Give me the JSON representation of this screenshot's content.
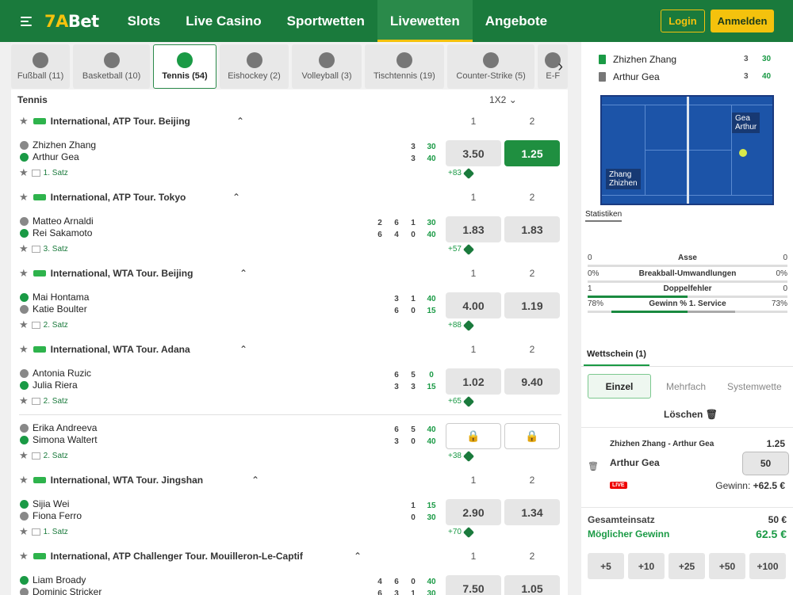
{
  "header": {
    "logo_a": "7A",
    "logo_b": "Bet",
    "nav": [
      "Slots",
      "Live Casino",
      "Sportwetten",
      "Livewetten",
      "Angebote"
    ],
    "login": "Login",
    "register": "Anmelden"
  },
  "sports": [
    {
      "label": "Fußball (11)",
      "icon": "soccer-ball-icon"
    },
    {
      "label": "Basketball (10)",
      "icon": "basketball-icon"
    },
    {
      "label": "Tennis (54)",
      "icon": "tennis-ball-icon"
    },
    {
      "label": "Eishockey (2)",
      "icon": "hockey-stick-icon"
    },
    {
      "label": "Volleyball (3)",
      "icon": "volleyball-icon"
    },
    {
      "label": "Tischtennis (19)",
      "icon": "table-tennis-icon"
    },
    {
      "label": "Counter-Strike (5)",
      "icon": "counter-strike-icon"
    },
    {
      "label": "E-F",
      "icon": "esports-icon"
    }
  ],
  "list": {
    "title": "Tennis",
    "market": "1X2",
    "col1": "1",
    "col2": "2",
    "leagues": [
      "International, ATP Tour. Beijing",
      "International, ATP Tour. Tokyo",
      "International, WTA Tour. Beijing",
      "International, WTA Tour. Adana",
      "International, WTA Tour. Jingshan",
      "International, ATP Challenger Tour. Mouilleron-Le-Captif"
    ],
    "matches": [
      {
        "p1": "Zhizhen Zhang",
        "p2": "Arthur Gea",
        "set": "1. Satz",
        "s1": [
          "3",
          "30"
        ],
        "s2": [
          "3",
          "40"
        ],
        "more": "+83",
        "o1": "3.50",
        "o2": "1.25"
      },
      {
        "p1": "Matteo Arnaldi",
        "p2": "Rei Sakamoto",
        "set": "3. Satz",
        "s1": [
          "2",
          "6",
          "1",
          "30"
        ],
        "s2": [
          "6",
          "4",
          "0",
          "40"
        ],
        "more": "+57",
        "o1": "1.83",
        "o2": "1.83"
      },
      {
        "p1": "Mai Hontama",
        "p2": "Katie Boulter",
        "set": "2. Satz",
        "s1": [
          "3",
          "1",
          "40"
        ],
        "s2": [
          "6",
          "0",
          "15"
        ],
        "more": "+88",
        "o1": "4.00",
        "o2": "1.19"
      },
      {
        "p1": "Antonia Ruzic",
        "p2": "Julia Riera",
        "set": "2. Satz",
        "s1": [
          "6",
          "5",
          "0"
        ],
        "s2": [
          "3",
          "3",
          "15"
        ],
        "more": "+65",
        "o1": "1.02",
        "o2": "9.40"
      },
      {
        "p1": "Erika Andreeva",
        "p2": "Simona Waltert",
        "set": "2. Satz",
        "s1": [
          "6",
          "5",
          "40"
        ],
        "s2": [
          "3",
          "0",
          "40"
        ],
        "more": "+38"
      },
      {
        "p1": "Sijia Wei",
        "p2": "Fiona Ferro",
        "set": "1. Satz",
        "s1": [
          "1",
          "15"
        ],
        "s2": [
          "0",
          "30"
        ],
        "more": "+70",
        "o1": "2.90",
        "o2": "1.34"
      },
      {
        "p1": "Liam Broady",
        "p2": "Dominic Stricker",
        "s1": [
          "4",
          "6",
          "0",
          "40"
        ],
        "s2": [
          "6",
          "3",
          "1",
          "30"
        ],
        "o1": "7.50",
        "o2": "1.05"
      }
    ]
  },
  "panel": {
    "team1": "Zhizhen Zhang",
    "team2": "Arthur Gea",
    "t1s": [
      "3",
      "30"
    ],
    "t2s": [
      "3",
      "40"
    ],
    "court_r": [
      "Gea",
      "Arthur"
    ],
    "court_l": [
      "Zhang",
      "Zhizhen"
    ],
    "stats_tab": "Statistiken",
    "stats": [
      {
        "label": "Asse",
        "l": "0",
        "r": "0"
      },
      {
        "label": "Breakball-Umwandlungen",
        "l": "0%",
        "r": "0%"
      },
      {
        "label": "Doppelfehler",
        "l": "1",
        "r": "0"
      },
      {
        "label": "Gewinn % 1. Service",
        "l": "78%",
        "r": "73%"
      }
    ]
  },
  "betslip": {
    "tab": "Wettschein (1)",
    "einzel": "Einzel",
    "mehrfach": "Mehrfach",
    "system": "Systemwette",
    "clear": "Löschen",
    "event": "Zhizhen Zhang - Arthur Gea",
    "odd": "1.25",
    "selection": "Arthur Gea",
    "stake": "50",
    "live": "LIVE",
    "win_label": "Gewinn:",
    "win_value": "+62.5 €",
    "total_label": "Gesamteinsatz",
    "total_value": "50 €",
    "possible_label": "Möglicher Gewinn",
    "possible_value": "62.5 €",
    "quick": [
      "+5",
      "+10",
      "+25",
      "+50",
      "+100"
    ]
  },
  "colors": {
    "brand": "#1a7a3c",
    "accent": "#f4c20d",
    "selected": "#1f8f40"
  }
}
